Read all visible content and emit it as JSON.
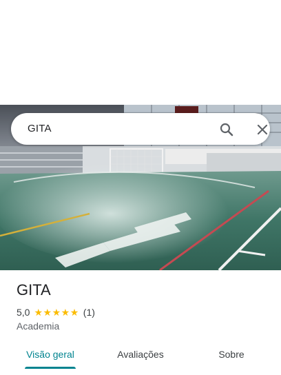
{
  "search": {
    "query": "GITA"
  },
  "place": {
    "name": "GITA",
    "rating": "5,0",
    "stars": [
      "★",
      "★",
      "★",
      "★",
      "★"
    ],
    "review_count": "(1)",
    "category": "Academia"
  },
  "tabs": [
    {
      "label": "Visão geral",
      "active": true
    },
    {
      "label": "Avaliações",
      "active": false
    },
    {
      "label": "Sobre",
      "active": false
    }
  ],
  "colors": {
    "accent": "#00838f",
    "star": "#fbbc04"
  }
}
